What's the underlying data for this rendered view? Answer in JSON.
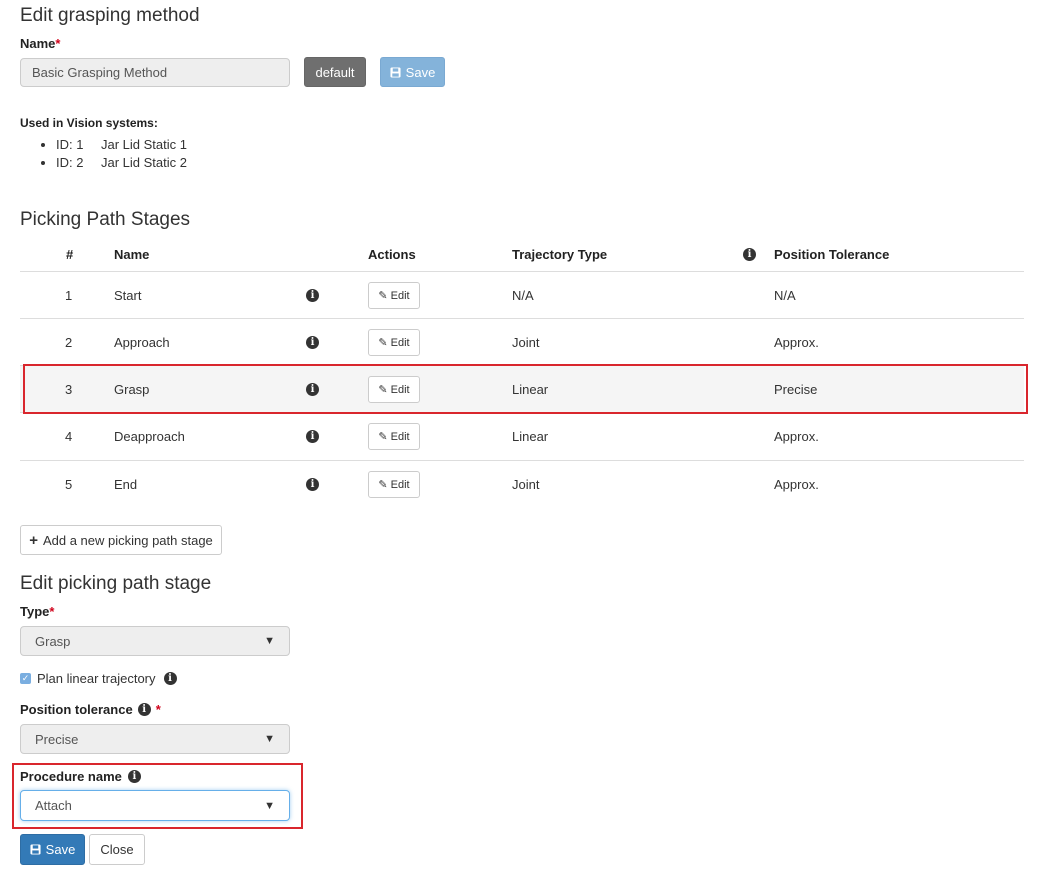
{
  "page_title": "Edit grasping method",
  "name_field": {
    "label": "Name",
    "required_mark": "*",
    "value": "Basic Grasping Method",
    "default_button": "default",
    "save_button": "Save"
  },
  "vision_systems": {
    "label": "Used in Vision systems:",
    "items": [
      {
        "id": "ID: 1",
        "name": "Jar Lid Static 1"
      },
      {
        "id": "ID: 2",
        "name": "Jar Lid Static 2"
      }
    ]
  },
  "stages_section": {
    "title": "Picking Path Stages",
    "headers": {
      "num": "#",
      "name": "Name",
      "actions": "Actions",
      "trajectory": "Trajectory Type",
      "tolerance": "Position Tolerance"
    },
    "edit_label": "Edit",
    "rows": [
      {
        "num": "1",
        "name": "Start",
        "trajectory": "N/A",
        "tolerance": "N/A"
      },
      {
        "num": "2",
        "name": "Approach",
        "trajectory": "Joint",
        "tolerance": "Approx."
      },
      {
        "num": "3",
        "name": "Grasp",
        "trajectory": "Linear",
        "tolerance": "Precise"
      },
      {
        "num": "4",
        "name": "Deapproach",
        "trajectory": "Linear",
        "tolerance": "Approx."
      },
      {
        "num": "5",
        "name": "End",
        "trajectory": "Joint",
        "tolerance": "Approx."
      }
    ],
    "add_button": "Add a new picking path stage"
  },
  "edit_stage": {
    "title": "Edit picking path stage",
    "type_label": "Type",
    "type_required": "*",
    "type_value": "Grasp",
    "plan_linear_label": "Plan linear trajectory",
    "plan_linear_checked": true,
    "tolerance_label": "Position tolerance",
    "tolerance_required": "*",
    "tolerance_value": "Precise",
    "procedure_label": "Procedure name",
    "procedure_value": "Attach",
    "save_button": "Save",
    "close_button": "Close"
  },
  "colors": {
    "primary": "#337ab7",
    "highlight": "#d9262d",
    "required": "#d0021b"
  }
}
